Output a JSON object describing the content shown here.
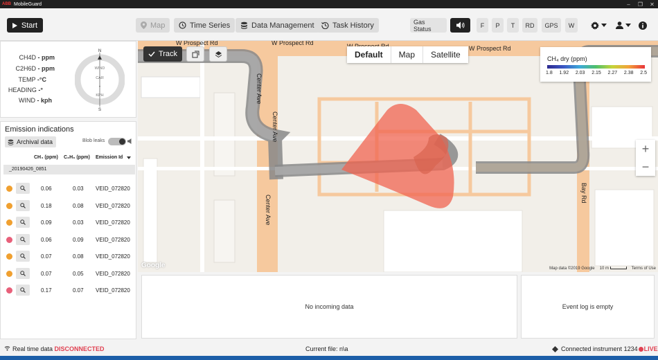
{
  "app": {
    "title": "MobileGuard",
    "logo_text": "ABB"
  },
  "window_controls": [
    "–",
    "❐",
    "✕"
  ],
  "toolbar": {
    "start_label": "Start",
    "nav": [
      {
        "label": "Map",
        "icon": "map-pin-icon",
        "state": "disabled"
      },
      {
        "label": "Time Series",
        "icon": "clock-icon"
      },
      {
        "label": "Data Management",
        "icon": "database-icon"
      },
      {
        "label": "Task History",
        "icon": "history-icon"
      }
    ],
    "gas_status_label": "Gas Status",
    "sound_icon": "speaker-icon",
    "letters": [
      "F",
      "P",
      "T",
      "RD",
      "GPS",
      "W"
    ],
    "settings_icon": "gear-icon",
    "user_icon": "user-icon",
    "info_icon": "info-icon"
  },
  "gauge": {
    "ch4_label": "CH4D",
    "ch4_value": "- ppm",
    "c2h6_label": "C2H6D",
    "c2h6_value": "- ppm",
    "temp_label": "TEMP",
    "temp_value": "-°C",
    "heading_label": "HEADING",
    "heading_value": "-°",
    "wind_label": "WIND",
    "wind_value": "- kph",
    "compass_n": "N",
    "compass_s": "S",
    "compass_wind": "WIND",
    "compass_car": "CAR",
    "compass_value": "-",
    "compass_unit": "KPH"
  },
  "emission": {
    "title": "Emission indications",
    "archival_label": "Archival data",
    "blob_label": "Blob leaks",
    "blob_on": true,
    "columns": [
      "CH₄ (ppm)",
      "C₂H₆ (ppm)",
      "Emission Id"
    ],
    "group": "_20190426_0851",
    "rows": [
      {
        "color": "#f0a030",
        "ch4": "0.06",
        "c2h6": "0.03",
        "id": "VEID_072820"
      },
      {
        "color": "#f0a030",
        "ch4": "0.18",
        "c2h6": "0.08",
        "id": "VEID_072820"
      },
      {
        "color": "#f0a030",
        "ch4": "0.09",
        "c2h6": "0.03",
        "id": "VEID_072820"
      },
      {
        "color": "#e8607a",
        "ch4": "0.06",
        "c2h6": "0.09",
        "id": "VEID_072820"
      },
      {
        "color": "#f0a030",
        "ch4": "0.07",
        "c2h6": "0.08",
        "id": "VEID_072820"
      },
      {
        "color": "#f0a030",
        "ch4": "0.07",
        "c2h6": "0.05",
        "id": "VEID_072820"
      },
      {
        "color": "#e8607a",
        "ch4": "0.17",
        "c2h6": "0.07",
        "id": "VEID_072820"
      }
    ]
  },
  "map": {
    "track_label": "Track",
    "types": [
      "Default",
      "Map",
      "Satellite"
    ],
    "active_type": "Default",
    "streets": {
      "prospect_1": "W Prospect Rd",
      "prospect_2": "W Prospect Rd",
      "prospect_3": "W Prospect Rd",
      "prospect_4": "W Prospect Rd",
      "center_1": "Center Ave",
      "center_2": "Center Ave",
      "center_3": "Center Ave",
      "bay": "Bay Rd"
    },
    "legend_title": "CH₄ dry (ppm)",
    "legend_ticks": [
      "1.8",
      "1.92",
      "2.03",
      "2.15",
      "2.27",
      "2.38",
      "2.5"
    ],
    "zoom_in": "+",
    "zoom_out": "−",
    "watermark": "Google",
    "attribution": "Map data ©2019 Google",
    "scale": "10 m",
    "terms": "Terms of Use"
  },
  "panels": {
    "incoming": "No incoming data",
    "eventlog": "Event log is empty"
  },
  "status": {
    "realtime_label": "Real time data",
    "realtime_state": "DISCONNECTED",
    "file_label": "Current file:",
    "file_value": "n\\a",
    "instrument_label": "Connected instrument",
    "instrument_id": "1234",
    "live": "LIVE"
  },
  "colors": {
    "accent": "#222222",
    "disconnected": "#e04050",
    "plume": "#f06450",
    "track": "#999999",
    "road": "#f6c99e"
  }
}
